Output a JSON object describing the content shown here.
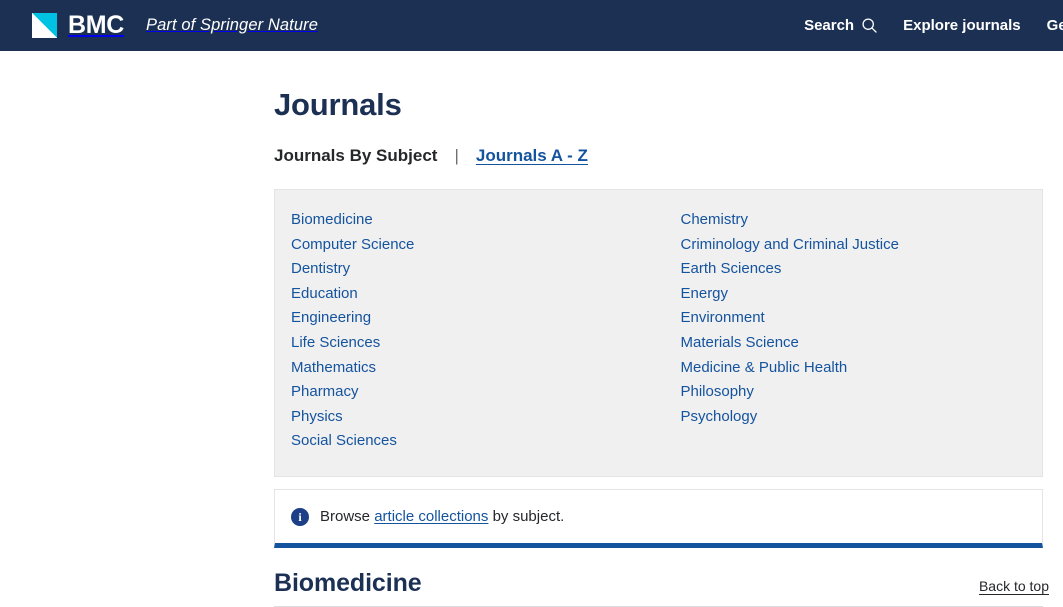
{
  "header": {
    "brand_name": "BMC",
    "brand_tagline": "Part of Springer Nature",
    "logo_icon": "bmc-triangle-logo",
    "nav": [
      {
        "label": "Search",
        "icon": "search-icon"
      },
      {
        "label": "Explore journals",
        "icon": null
      },
      {
        "label": "Get p",
        "icon": null
      }
    ]
  },
  "main": {
    "page_title": "Journals",
    "subnav": {
      "current_label": "Journals By Subject",
      "separator": "|",
      "link_label": "Journals A - Z"
    },
    "subject_box": {
      "left_column": [
        "Biomedicine",
        "Computer Science",
        "Dentistry",
        "Education",
        "Engineering",
        "Life Sciences",
        "Mathematics",
        "Pharmacy",
        "Physics",
        "Social Sciences"
      ],
      "right_column": [
        "Chemistry",
        "Criminology and Criminal Justice",
        "Earth Sciences",
        "Energy",
        "Environment",
        "Materials Science",
        "Medicine & Public Health",
        "Philosophy",
        "Psychology"
      ]
    },
    "info_box": {
      "icon": "info-icon",
      "text_before": "Browse ",
      "link_label": "article collections",
      "text_after": " by subject."
    },
    "section": {
      "title": "Biomedicine",
      "back_to_top_label": "Back to top"
    }
  },
  "colors": {
    "header_navy": "#1c3054",
    "accent_cyan": "#00c3e3",
    "link_blue": "#14539e",
    "box_gray": "#f0f0f0",
    "text_dark": "#26272b"
  }
}
